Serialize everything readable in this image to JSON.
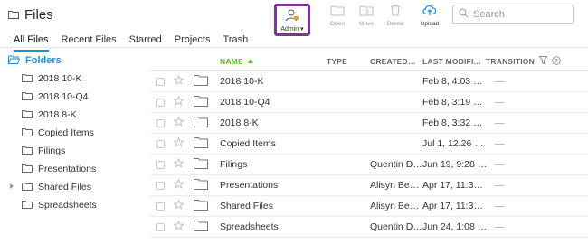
{
  "app": {
    "title": "Files"
  },
  "tabs": [
    {
      "label": "All Files",
      "active": true
    },
    {
      "label": "Recent Files",
      "active": false
    },
    {
      "label": "Starred",
      "active": false
    },
    {
      "label": "Projects",
      "active": false
    },
    {
      "label": "Trash",
      "active": false
    }
  ],
  "toolbar": {
    "admin": "Admin",
    "open": "Open",
    "move": "Move",
    "delete": "Delete",
    "upload": "Upload"
  },
  "search": {
    "placeholder": "Search"
  },
  "sidebar": {
    "heading": "Folders",
    "items": [
      {
        "label": "2018 10-K",
        "expandable": false
      },
      {
        "label": "2018 10-Q4",
        "expandable": false
      },
      {
        "label": "2018 8-K",
        "expandable": false
      },
      {
        "label": "Copied Items",
        "expandable": false
      },
      {
        "label": "Filings",
        "expandable": false
      },
      {
        "label": "Presentations",
        "expandable": false
      },
      {
        "label": "Shared Files",
        "expandable": true
      },
      {
        "label": "Spreadsheets",
        "expandable": false
      }
    ]
  },
  "table": {
    "columns": {
      "name": "NAME",
      "type": "TYPE",
      "created": "CREATED…",
      "modified": "LAST MODIFI…",
      "transition": "TRANSITION"
    },
    "rows": [
      {
        "name": "2018 10-K",
        "type": "",
        "created": "",
        "modified": "Feb 8, 4:03 …",
        "transition": "—"
      },
      {
        "name": "2018 10-Q4",
        "type": "",
        "created": "",
        "modified": "Feb 8, 3:19 …",
        "transition": "—"
      },
      {
        "name": "2018 8-K",
        "type": "",
        "created": "",
        "modified": "Feb 8, 3:32 …",
        "transition": "—"
      },
      {
        "name": "Copied Items",
        "type": "",
        "created": "",
        "modified": "Jul 1, 12:26 …",
        "transition": "—"
      },
      {
        "name": "Filings",
        "type": "",
        "created": "Quentin D…",
        "modified": "Jun 19, 9:28 …",
        "transition": "—"
      },
      {
        "name": "Presentations",
        "type": "",
        "created": "Alisyn Be…",
        "modified": "Apr 17, 11:3…",
        "transition": "—"
      },
      {
        "name": "Shared Files",
        "type": "",
        "created": "Alisyn Be…",
        "modified": "Apr 17, 11:3…",
        "transition": "—"
      },
      {
        "name": "Spreadsheets",
        "type": "",
        "created": "Quentin D…",
        "modified": "Jun 24, 1:08 …",
        "transition": "—"
      }
    ]
  },
  "colors": {
    "accent": "#1a8fd6",
    "sort_green": "#5cb82a",
    "highlight": "#7a3596"
  }
}
